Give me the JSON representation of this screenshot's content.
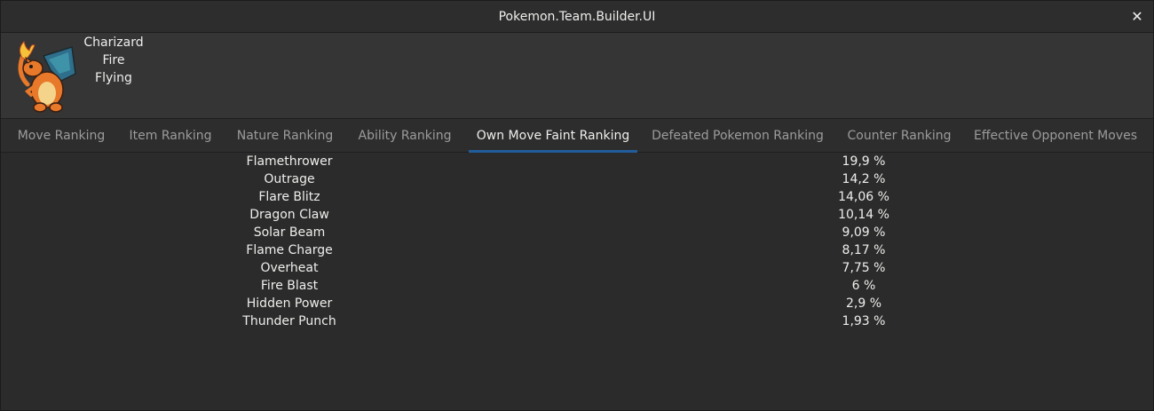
{
  "window": {
    "title": "Pokemon.Team.Builder.UI",
    "close_glyph": "✕"
  },
  "pokemon": {
    "name": "Charizard",
    "type1": "Fire",
    "type2": "Flying"
  },
  "tabs": [
    {
      "label": "Move Ranking",
      "active": false
    },
    {
      "label": "Item Ranking",
      "active": false
    },
    {
      "label": "Nature Ranking",
      "active": false
    },
    {
      "label": "Ability Ranking",
      "active": false
    },
    {
      "label": "Own Move Faint Ranking",
      "active": true
    },
    {
      "label": "Defeated Pokemon Ranking",
      "active": false
    },
    {
      "label": "Counter Ranking",
      "active": false
    },
    {
      "label": "Effective Opponent Moves",
      "active": false
    }
  ],
  "ranking": [
    {
      "move": "Flamethrower",
      "percent": "19,9 %"
    },
    {
      "move": "Outrage",
      "percent": "14,2 %"
    },
    {
      "move": "Flare Blitz",
      "percent": "14,06 %"
    },
    {
      "move": "Dragon Claw",
      "percent": "10,14 %"
    },
    {
      "move": "Solar Beam",
      "percent": "9,09 %"
    },
    {
      "move": "Flame Charge",
      "percent": "8,17 %"
    },
    {
      "move": "Overheat",
      "percent": "7,75 %"
    },
    {
      "move": "Fire Blast",
      "percent": "6 %"
    },
    {
      "move": "Hidden Power",
      "percent": "2,9 %"
    },
    {
      "move": "Thunder Punch",
      "percent": "1,93 %"
    }
  ],
  "colors": {
    "accent": "#215d9c",
    "text": "#eeeeec",
    "inactive_tab_text": "#9a9c9a"
  },
  "icons": {
    "sprite": "charizard-sprite-icon",
    "close": "close-icon"
  }
}
